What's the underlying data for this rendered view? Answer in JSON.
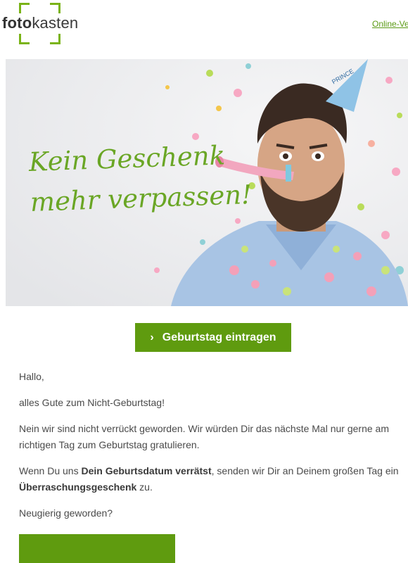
{
  "header": {
    "logo_bold": "foto",
    "logo_light": "kasten",
    "link_text": "Online-Ver"
  },
  "hero": {
    "headline_line1": "Kein Geschenk",
    "headline_line2": "mehr verpassen!",
    "hat_text": "PRINCE",
    "accent_color": "#6aa625"
  },
  "cta_primary": {
    "chevron": "›",
    "label": "Geburtstag eintragen"
  },
  "body": {
    "greeting": "Hallo,",
    "line1": "alles Gute zum Nicht-Geburtstag!",
    "para2": "Nein wir sind nicht verrückt geworden. Wir würden Dir das nächste Mal nur gerne am richtigen Tag zum Geburtstag gratulieren.",
    "para3_a": "Wenn Du uns ",
    "para3_b": "Dein Geburtsdatum verrätst",
    "para3_c": ", senden wir Dir an Deinem großen Tag ein ",
    "para3_d": "Überraschungsgeschenk",
    "para3_e": " zu.",
    "question": "Neugierig geworden?"
  },
  "colors": {
    "brand_green": "#5f9b0f",
    "link_green": "#5a9a14"
  }
}
